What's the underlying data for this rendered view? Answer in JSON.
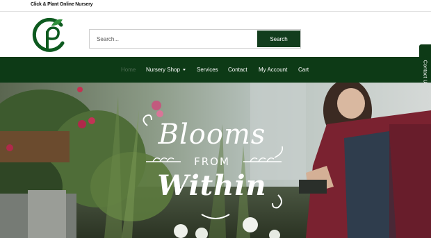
{
  "topbar": {
    "site_name": "Click & Plant Online Nursery"
  },
  "logo": {
    "icon": "cp-leaf-logo-icon"
  },
  "search": {
    "placeholder": "Search...",
    "button_label": "Search"
  },
  "nav": {
    "items": [
      {
        "label": "Home",
        "active": true
      },
      {
        "label": "Nursery Shop",
        "has_dropdown": true
      },
      {
        "label": "Services"
      },
      {
        "label": "Contact"
      },
      {
        "label": "My Account"
      },
      {
        "label": "Cart"
      }
    ]
  },
  "contact_tab": {
    "label": "Contact Us"
  },
  "hero": {
    "line1": "Blooms",
    "line2": "FROM",
    "line3": "Within"
  },
  "colors": {
    "brand_green": "#0d3a16",
    "button_green": "#123d1d",
    "active_nav": "#4d6b52"
  }
}
